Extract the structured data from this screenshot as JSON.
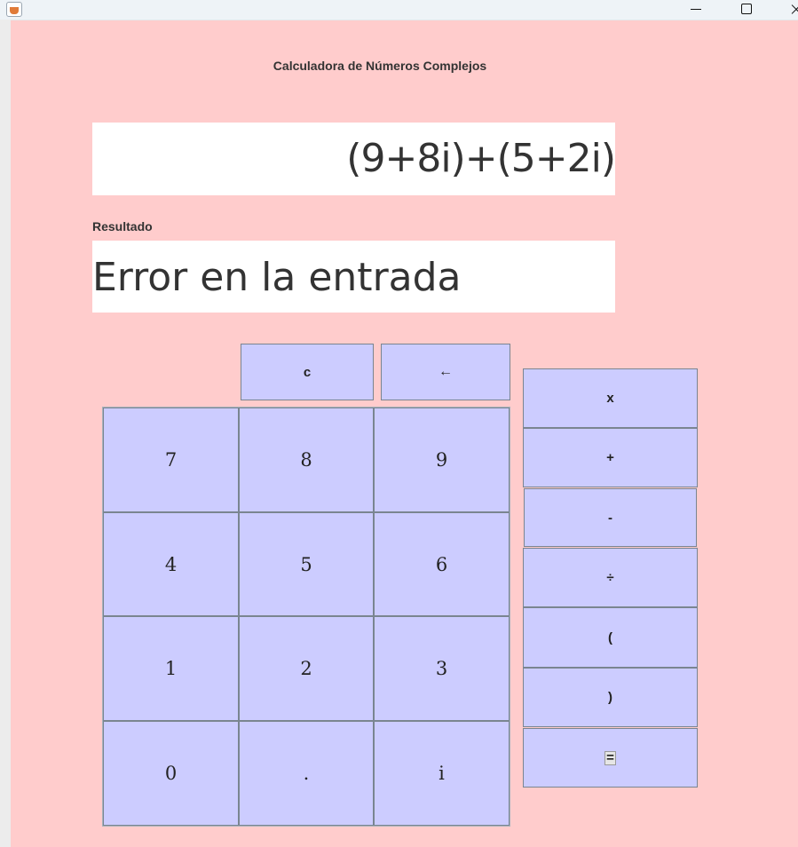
{
  "window": {
    "title": ""
  },
  "app": {
    "title": "Calculadora de Números Complejos",
    "expression": "(9+8i)+(5+2i)",
    "result_label": "Resultado",
    "result": "Error en la entrada"
  },
  "controls": {
    "clear": "c",
    "backspace": "←"
  },
  "keypad": [
    "7",
    "8",
    "9",
    "4",
    "5",
    "6",
    "1",
    "2",
    "3",
    "0",
    ".",
    "i"
  ],
  "operators": [
    "x",
    "+",
    "-",
    "÷",
    "(",
    ")",
    "="
  ],
  "colors": {
    "background": "#ffcccc",
    "button": "#ccccff",
    "display": "#ffffff"
  }
}
